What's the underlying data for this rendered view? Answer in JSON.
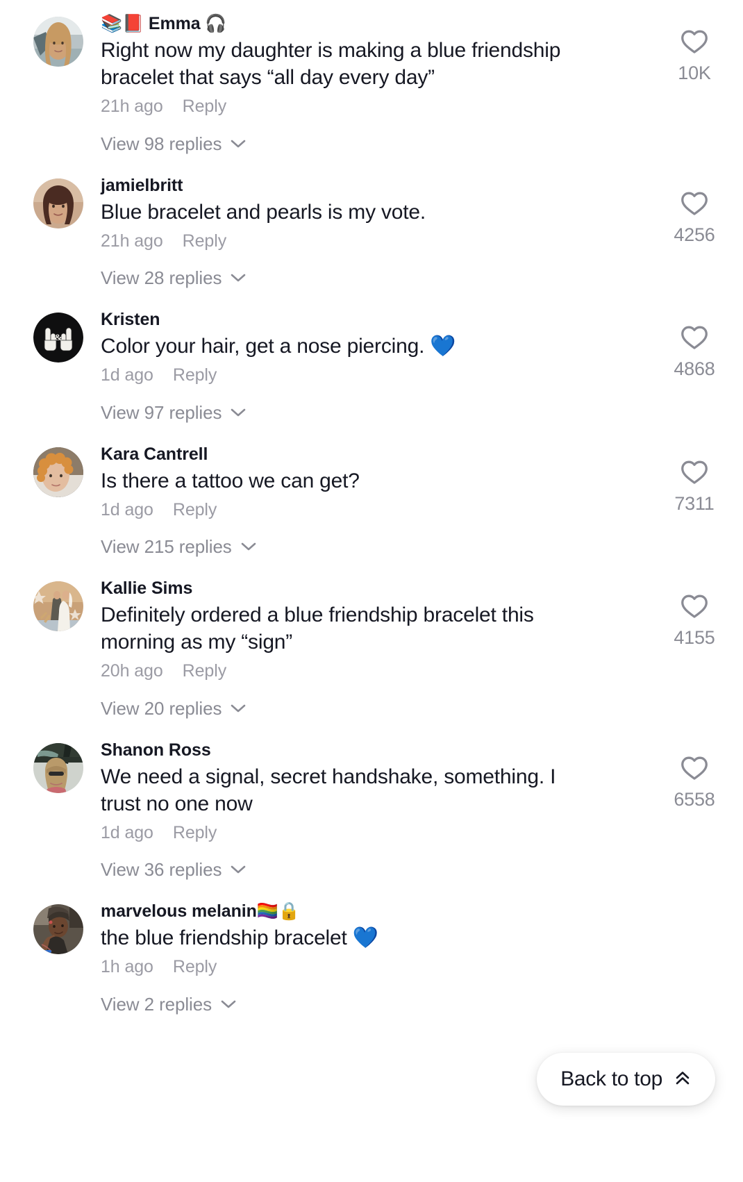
{
  "screen": {
    "name": "comment-list",
    "background_color": "#ffffff",
    "text_color": "#161823",
    "muted_text_color": "#8a8b94"
  },
  "comments": [
    {
      "author": "📚📕 Emma 🎧",
      "text": "Right now my daughter is making a blue friendship bracelet that says “all day every day”",
      "time": "21h ago",
      "reply_label": "Reply",
      "view_replies": "View 98 replies",
      "like_count": "10K",
      "avatar_name": "avatar-emma"
    },
    {
      "author": "jamielbritt",
      "text": "Blue bracelet and pearls is my vote.",
      "time": "21h ago",
      "reply_label": "Reply",
      "view_replies": "View 28 replies",
      "like_count": "4256",
      "avatar_name": "avatar-jamielbritt"
    },
    {
      "author": "Kristen",
      "text": "Color your hair, get a nose piercing. 💙",
      "time": "1d ago",
      "reply_label": "Reply",
      "view_replies": "View 97 replies",
      "like_count": "4868",
      "avatar_name": "avatar-kristen"
    },
    {
      "author": "Kara Cantrell",
      "text": "Is there a tattoo we can get?",
      "time": "1d ago",
      "reply_label": "Reply",
      "view_replies": "View 215 replies",
      "like_count": "7311",
      "avatar_name": "avatar-kara-cantrell"
    },
    {
      "author": "Kallie Sims",
      "text": "Definitely ordered a blue friendship bracelet this morning as my “sign”",
      "time": "20h ago",
      "reply_label": "Reply",
      "view_replies": "View 20 replies",
      "like_count": "4155",
      "avatar_name": "avatar-kallie-sims"
    },
    {
      "author": "Shanon Ross",
      "text": "We need a signal, secret handshake, something. I trust no one now",
      "time": "1d ago",
      "reply_label": "Reply",
      "view_replies": "View 36 replies",
      "like_count": "6558",
      "avatar_name": "avatar-shanon-ross"
    },
    {
      "author": "marvelous melanin🏳️‍🌈🔒",
      "text": "the blue friendship bracelet 💙",
      "time": "1h ago",
      "reply_label": "Reply",
      "view_replies": "View 2 replies",
      "like_count": "",
      "avatar_name": "avatar-marvelous-melanin"
    }
  ],
  "back_to_top": {
    "label": "Back to top",
    "icon": "chevron-double-up-icon"
  }
}
